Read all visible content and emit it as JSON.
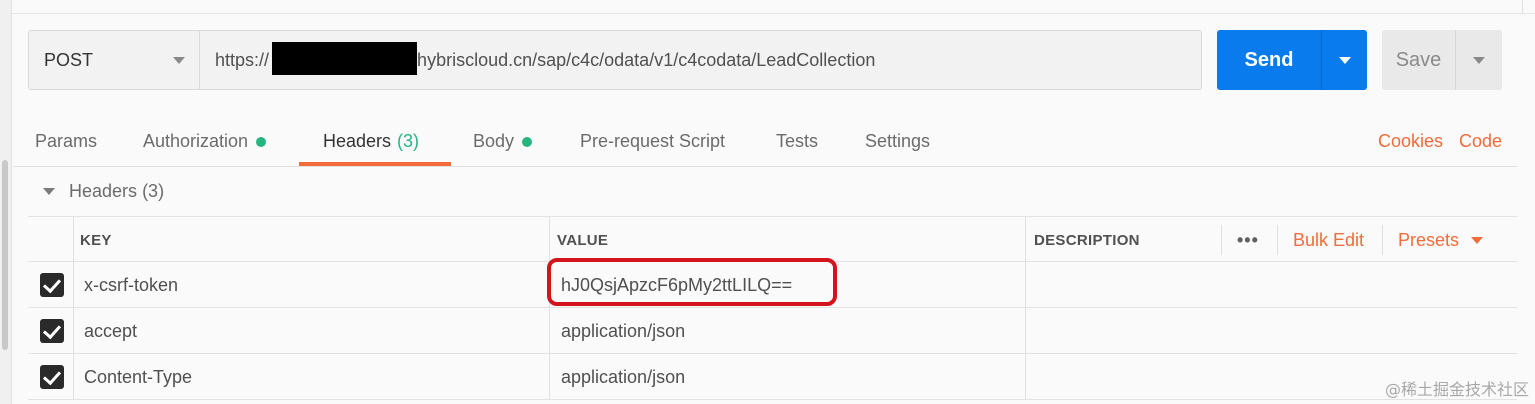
{
  "request": {
    "method": "POST",
    "url_prefix": "https://",
    "url_suffix": "aphybriscloud.cn/sap/c4c/odata/v1/c4codata/LeadCollection",
    "send_label": "Send",
    "save_label": "Save"
  },
  "tabs": [
    {
      "label": "Params"
    },
    {
      "label": "Authorization"
    },
    {
      "label": "Headers",
      "count": "(3)"
    },
    {
      "label": "Body"
    },
    {
      "label": "Pre-request Script"
    },
    {
      "label": "Tests"
    },
    {
      "label": "Settings"
    }
  ],
  "tab_links": {
    "cookies": "Cookies",
    "code": "Code"
  },
  "headers_section": {
    "title": "Headers",
    "count": "(3)",
    "columns": {
      "key": "KEY",
      "value": "VALUE",
      "description": "DESCRIPTION"
    },
    "more": "•••",
    "bulk_edit": "Bulk Edit",
    "presets": "Presets",
    "rows": [
      {
        "key": "x-csrf-token",
        "value": "hJ0QsjApzcF6pMy2ttLILQ==",
        "description": ""
      },
      {
        "key": "accept",
        "value": "application/json",
        "description": ""
      },
      {
        "key": "Content-Type",
        "value": "application/json",
        "description": ""
      }
    ]
  },
  "watermark": "@稀土掘金技术社区",
  "colors": {
    "accent": "#f26b3a",
    "send": "#097bed",
    "status_dot": "#26b47f",
    "highlight": "#d4141d"
  }
}
